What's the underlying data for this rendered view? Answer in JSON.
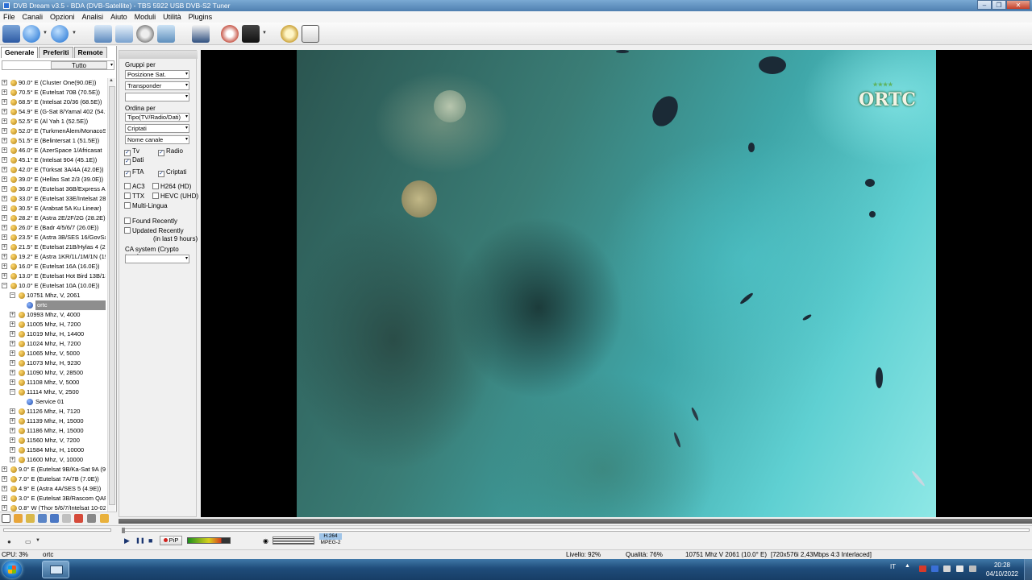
{
  "window": {
    "title": "DVB Dream v3.5  -  BDA (DVB-Satellite)  -  TBS 5922 USB DVB-S2 Tuner",
    "min": "–",
    "max": "❐",
    "close": "✕"
  },
  "menu": [
    "File",
    "Canali",
    "Opzioni",
    "Analisi",
    "Aiuto",
    "Moduli",
    "Utilità",
    "Plugins"
  ],
  "toolbar_icons": [
    "channel-list-icon",
    "back-icon",
    "forward-icon",
    "screen-icon",
    "window-icon",
    "settings-gear-icon",
    "snapshot-icon",
    "epg-icon",
    "record-stop-icon",
    "remote-icon",
    "clock-icon",
    "analyzer-icon"
  ],
  "tabs": [
    "Generale",
    "Preferiti",
    "Remote"
  ],
  "filter": {
    "value": "Tutto",
    "dd": "▾"
  },
  "tree": [
    {
      "exp": "+",
      "icon": "sat",
      "indent": 0,
      "label": "90.0° E (Cluster One(90.0E))"
    },
    {
      "exp": "+",
      "icon": "sat",
      "indent": 0,
      "label": "70.5° E (Eutelsat 70B (70.5E))"
    },
    {
      "exp": "+",
      "icon": "sat",
      "indent": 0,
      "label": "68.5° E (Intelsat 20/36 (68.5E))"
    },
    {
      "exp": "+",
      "icon": "sat",
      "indent": 0,
      "label": "54.9° E (G-Sat 8/Yamal 402 (54.9"
    },
    {
      "exp": "+",
      "icon": "sat",
      "indent": 0,
      "label": "52.5° E (Al Yah 1 (52.5E))"
    },
    {
      "exp": "+",
      "icon": "sat",
      "indent": 0,
      "label": "52.0° E (TurkmenÄlem/MonacoSa"
    },
    {
      "exp": "+",
      "icon": "sat",
      "indent": 0,
      "label": "51.5° E (Belintersat 1 (51.5E))"
    },
    {
      "exp": "+",
      "icon": "sat",
      "indent": 0,
      "label": "46.0° E (AzerSpace 1/Africasat"
    },
    {
      "exp": "+",
      "icon": "sat",
      "indent": 0,
      "label": "45.1° E (Intelsat 904 (45.1E))"
    },
    {
      "exp": "+",
      "icon": "sat",
      "indent": 0,
      "label": "42.0° E (Türksat 3A/4A (42.0E))"
    },
    {
      "exp": "+",
      "icon": "sat",
      "indent": 0,
      "label": "39.0° E (Hellas Sat 2/3 (39.0E))"
    },
    {
      "exp": "+",
      "icon": "sat",
      "indent": 0,
      "label": "36.0° E (Eutelsat 36B/Express AM"
    },
    {
      "exp": "+",
      "icon": "sat",
      "indent": 0,
      "label": "33.0° E (Eutelsat 33E/Intelsat 28 ("
    },
    {
      "exp": "+",
      "icon": "sat",
      "indent": 0,
      "label": "30.5° E (Arabsat 5A Ku Linear)"
    },
    {
      "exp": "+",
      "icon": "sat",
      "indent": 0,
      "label": "28.2° E (Astra 2E/2F/2G (28.2E))"
    },
    {
      "exp": "+",
      "icon": "sat",
      "indent": 0,
      "label": "26.0° E (Badr 4/5/6/7 (26.0E))"
    },
    {
      "exp": "+",
      "icon": "sat",
      "indent": 0,
      "label": "23.5° E (Astra 3B/SES 16/GovSat"
    },
    {
      "exp": "+",
      "icon": "sat",
      "indent": 0,
      "label": "21.5° E (Eutelsat 21B/Hylas 4 (21"
    },
    {
      "exp": "+",
      "icon": "sat",
      "indent": 0,
      "label": "19.2° E (Astra 1KR/1L/1M/1N (19"
    },
    {
      "exp": "+",
      "icon": "sat",
      "indent": 0,
      "label": "16.0° E (Eutelsat 16A (16.0E))"
    },
    {
      "exp": "+",
      "icon": "sat",
      "indent": 0,
      "label": "13.0° E (Eutelsat Hot Bird 13B/13"
    },
    {
      "exp": "−",
      "icon": "sat",
      "indent": 0,
      "label": "10.0° E (Eutelsat 10A (10.0E))"
    },
    {
      "exp": "−",
      "icon": "sat",
      "indent": 1,
      "label": "10751 Mhz, V, 2061"
    },
    {
      "exp": "",
      "icon": "svc",
      "indent": 2,
      "label": "ortc",
      "selected": true
    },
    {
      "exp": "+",
      "icon": "sat",
      "indent": 1,
      "label": "10993 Mhz, V, 4000"
    },
    {
      "exp": "+",
      "icon": "sat",
      "indent": 1,
      "label": "11005 Mhz, H, 7200"
    },
    {
      "exp": "+",
      "icon": "sat",
      "indent": 1,
      "label": "11019 Mhz, H, 14400"
    },
    {
      "exp": "+",
      "icon": "sat",
      "indent": 1,
      "label": "11024 Mhz, H, 7200"
    },
    {
      "exp": "+",
      "icon": "sat",
      "indent": 1,
      "label": "11065 Mhz, V, 5000"
    },
    {
      "exp": "+",
      "icon": "sat",
      "indent": 1,
      "label": "11073 Mhz, H, 9230"
    },
    {
      "exp": "+",
      "icon": "sat",
      "indent": 1,
      "label": "11090 Mhz, V, 28500"
    },
    {
      "exp": "+",
      "icon": "sat",
      "indent": 1,
      "label": "11108 Mhz, V, 5000"
    },
    {
      "exp": "−",
      "icon": "sat",
      "indent": 1,
      "label": "11114 Mhz, V, 2500"
    },
    {
      "exp": "",
      "icon": "svc",
      "indent": 2,
      "label": "Service 01"
    },
    {
      "exp": "+",
      "icon": "sat",
      "indent": 1,
      "label": "11126 Mhz, H, 7120"
    },
    {
      "exp": "+",
      "icon": "sat",
      "indent": 1,
      "label": "11139 Mhz, H, 15000"
    },
    {
      "exp": "+",
      "icon": "sat",
      "indent": 1,
      "label": "11186 Mhz, H, 15000"
    },
    {
      "exp": "+",
      "icon": "sat",
      "indent": 1,
      "label": "11560 Mhz, V, 7200"
    },
    {
      "exp": "+",
      "icon": "sat",
      "indent": 1,
      "label": "11584 Mhz, H, 10000"
    },
    {
      "exp": "+",
      "icon": "sat",
      "indent": 1,
      "label": "11600 Mhz, V, 10000"
    },
    {
      "exp": "+",
      "icon": "sat",
      "indent": 0,
      "label": "9.0° E (Eutelsat 9B/Ka-Sat 9A (9."
    },
    {
      "exp": "+",
      "icon": "sat",
      "indent": 0,
      "label": "7.0° E (Eutelsat 7A/7B (7.0E))"
    },
    {
      "exp": "+",
      "icon": "sat",
      "indent": 0,
      "label": "4.9° E (Astra 4A/SES 5 (4.9E))"
    },
    {
      "exp": "+",
      "icon": "sat",
      "indent": 0,
      "label": "3.0° E (Eutelsat 3B/Rascom QAF"
    },
    {
      "exp": "+",
      "icon": "sat",
      "indent": 0,
      "label": "0.8° W (Thor 5/6/7/Intelsat 10-02"
    }
  ],
  "filters": {
    "gruppi_label": "Gruppi per",
    "gruppi": [
      "Posizione Sat.",
      "Transponder",
      ""
    ],
    "ordina_label": "Ordina per",
    "ordina": [
      "Tipo(TV/Radio/Dati)",
      "Criptati",
      "Nome canale"
    ],
    "tv": "Tv",
    "radio": "Radio",
    "dati": "Dati",
    "fta": "FTA",
    "criptati": "Criptati",
    "ac3": "AC3",
    "h264": "H264 (HD)",
    "ttx": "TTX",
    "hevc": "HEVC (UHD)",
    "multilingua": "Multi-Lingua",
    "found": "Found Recently",
    "updated": "Updated Recently",
    "updated_sub": "(in last 9 hours)",
    "ca_label": "CA system (Crypto type):",
    "check": "✓",
    "dd": "▾"
  },
  "video": {
    "logo": "ORTC",
    "stars": "★★★★"
  },
  "controls": {
    "play": "▶",
    "pause": "❚❚",
    "stop": "■",
    "pip": "PiP",
    "codec_video": "H.264",
    "codec_audio": "MPEG-2"
  },
  "status": {
    "cpu": "CPU: 3%",
    "channel": "ortc",
    "level": "Livello: 92%",
    "quality": "Qualità: 76%",
    "tp": "10751 Mhz  V  2061  (10.0° E)",
    "format": "[720x576i  2,43Mbps  4:3 Interlaced]"
  },
  "taskbar": {
    "lang": "IT",
    "time": "20:28",
    "date": "04/10/2022"
  },
  "colors": {
    "title_blue": "#4f7fb0",
    "selection": "#8e8e8e",
    "taskbar": "#1f4c7a"
  }
}
